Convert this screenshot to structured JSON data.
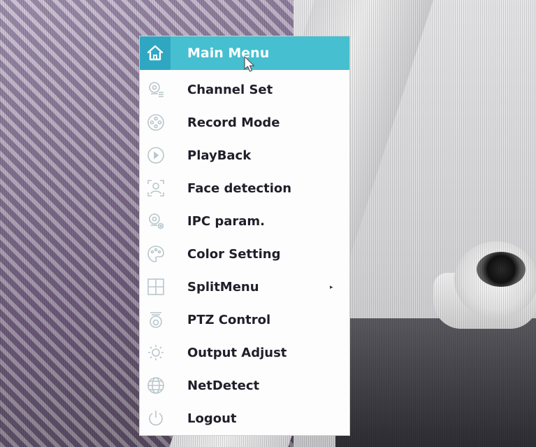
{
  "menu": {
    "title": "Main Menu",
    "header_icon": "home-icon",
    "items": [
      {
        "label": "Channel Set",
        "icon": "camera-settings-icon",
        "has_submenu": false
      },
      {
        "label": "Record Mode",
        "icon": "record-reel-icon",
        "has_submenu": false
      },
      {
        "label": "PlayBack",
        "icon": "play-circle-icon",
        "has_submenu": false
      },
      {
        "label": "Face detection",
        "icon": "face-detection-icon",
        "has_submenu": false
      },
      {
        "label": "IPC param.",
        "icon": "ipc-camera-gear-icon",
        "has_submenu": false
      },
      {
        "label": "Color Setting",
        "icon": "palette-icon",
        "has_submenu": false
      },
      {
        "label": "SplitMenu",
        "icon": "grid-split-icon",
        "has_submenu": true,
        "arrow": "▸"
      },
      {
        "label": "PTZ Control",
        "icon": "ptz-camera-icon",
        "has_submenu": false
      },
      {
        "label": "Output Adjust",
        "icon": "sun-brightness-icon",
        "has_submenu": false
      },
      {
        "label": "NetDetect",
        "icon": "globe-icon",
        "has_submenu": false
      },
      {
        "label": "Logout",
        "icon": "power-icon",
        "has_submenu": false
      }
    ]
  },
  "colors": {
    "header_bg": "#46bfd0",
    "home_bg": "#2fa7c2",
    "menu_bg": "#fdfdfd",
    "text": "#1f1f2a",
    "icon_stroke": "#b9c6cc"
  }
}
